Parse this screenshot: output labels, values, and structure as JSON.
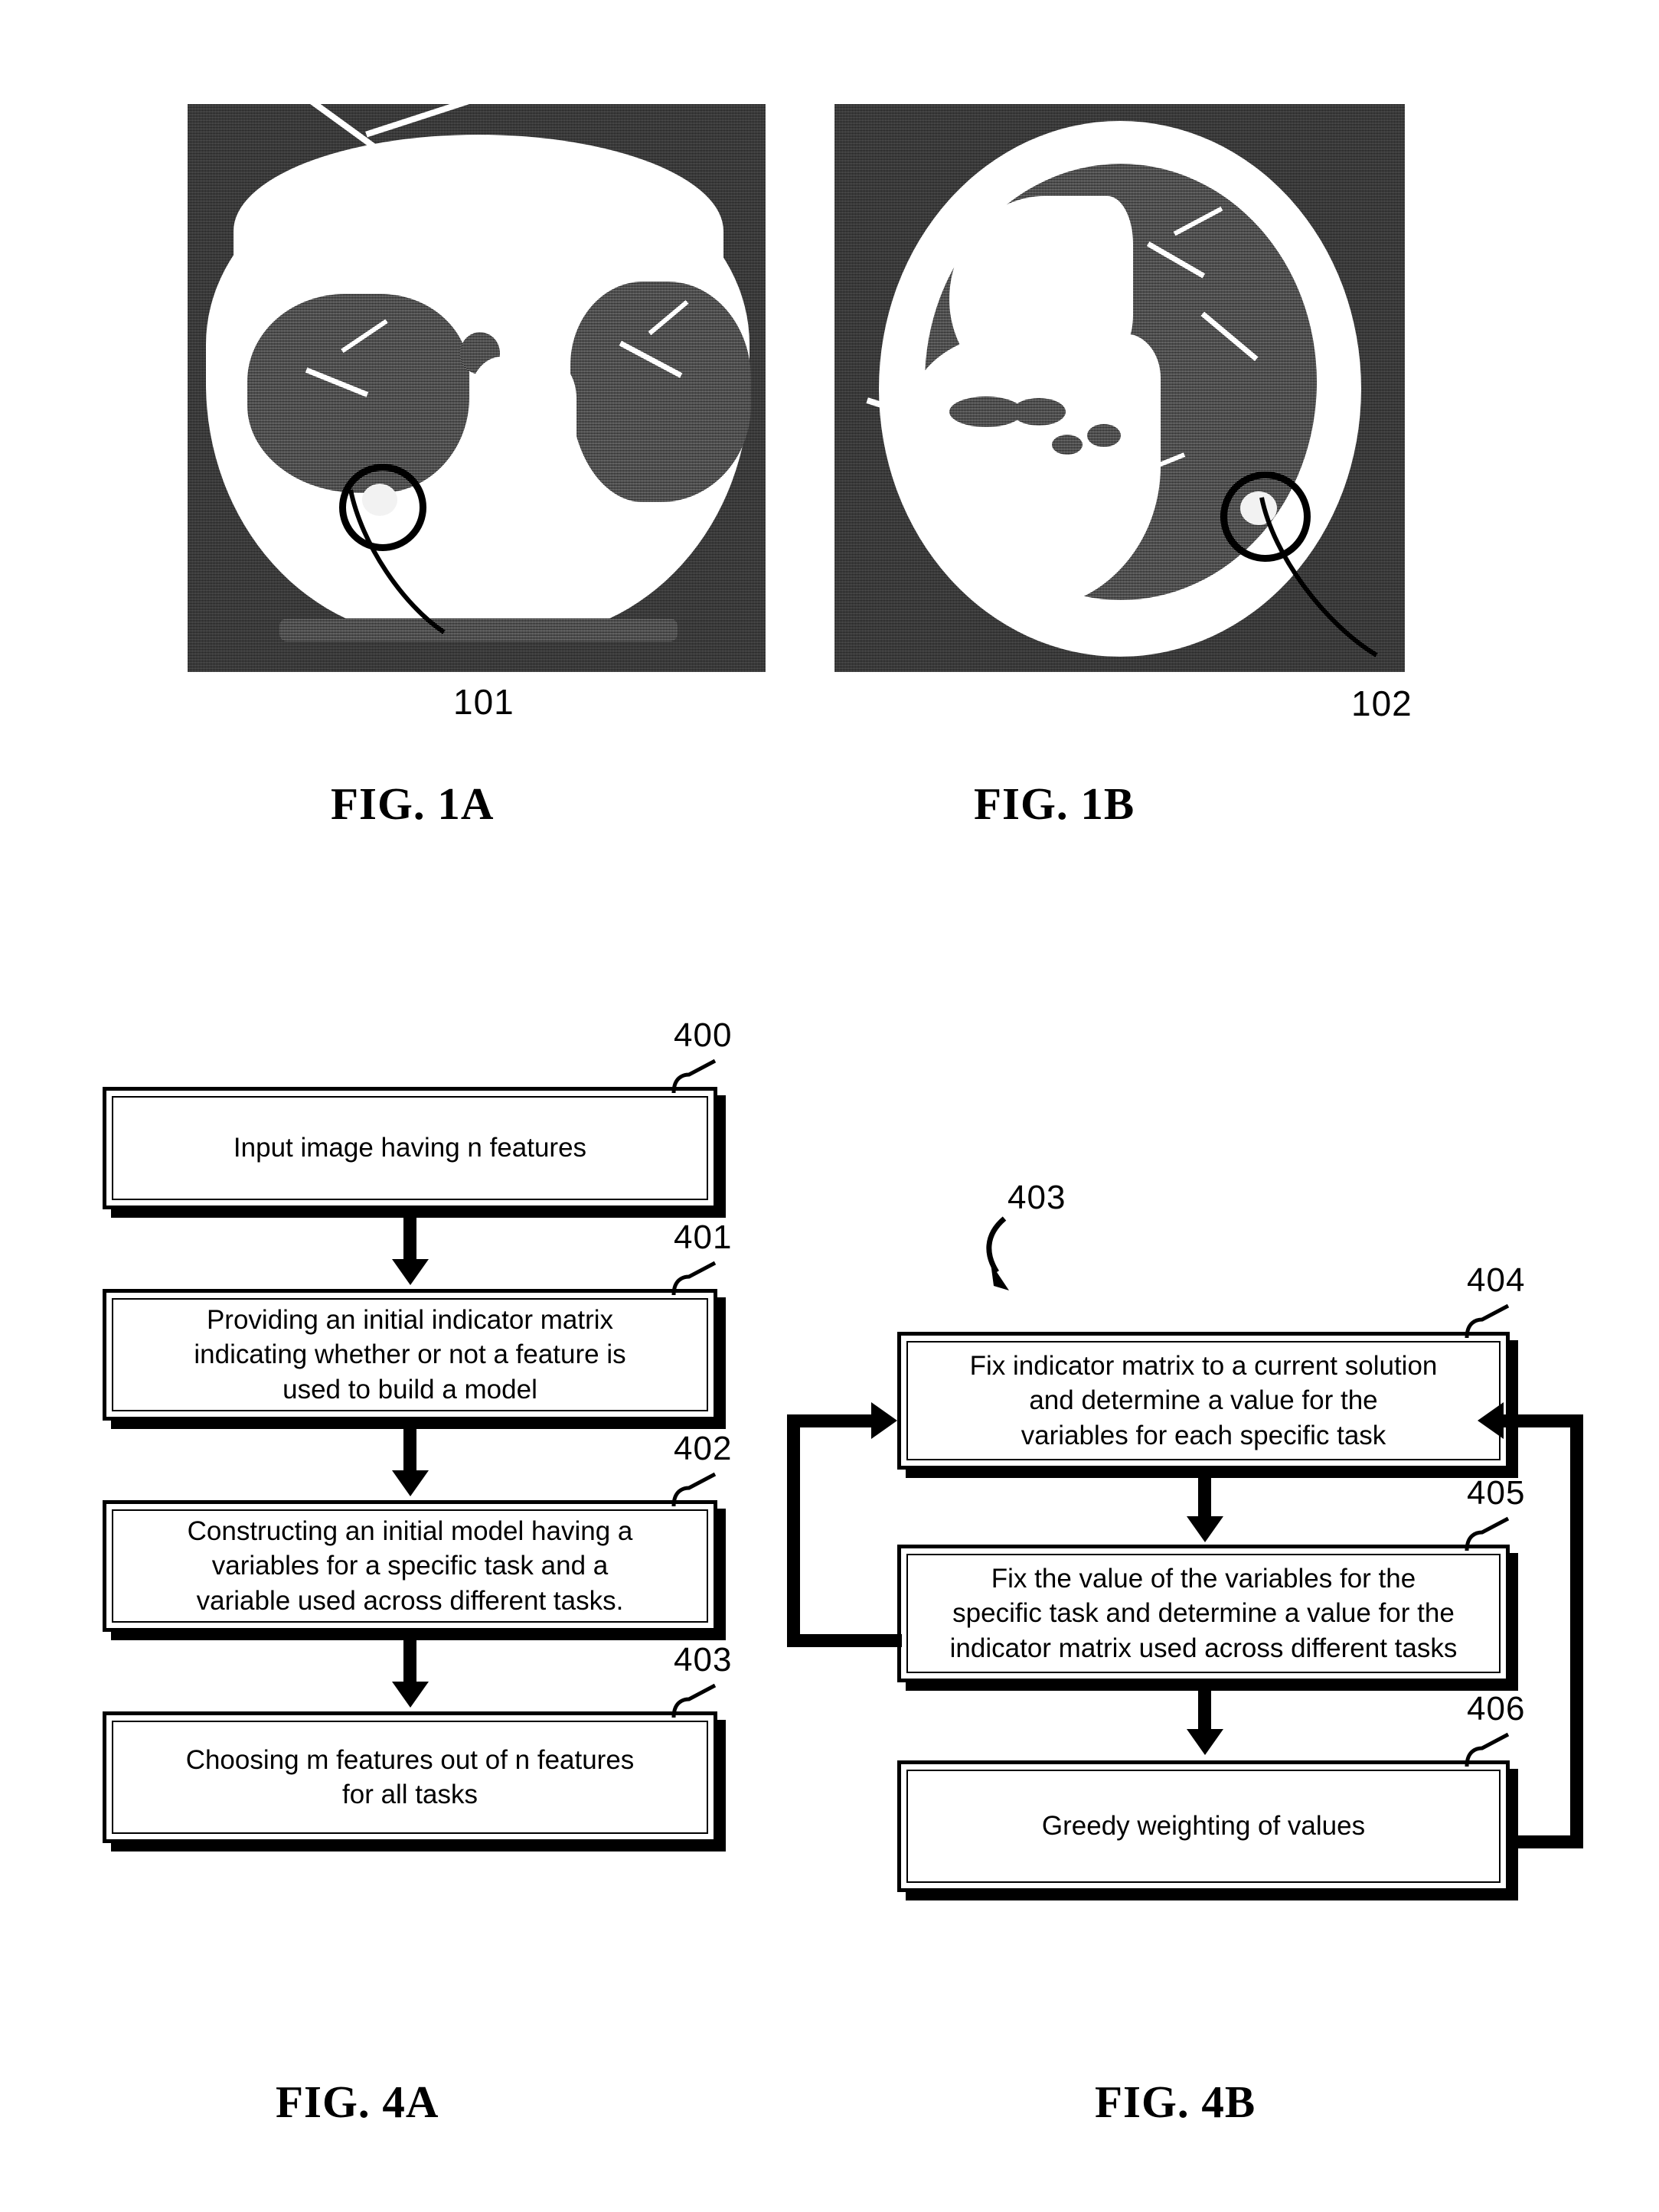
{
  "figures": {
    "fig1a": {
      "caption": "FIG. 1A",
      "ref_label": "101",
      "description": "axial CT slice of chest with circled lung nodule"
    },
    "fig1b": {
      "caption": "FIG. 1B",
      "ref_label": "102",
      "description": "axial CT slice of chest with circled lung nodule"
    },
    "fig4a": {
      "caption": "FIG. 4A",
      "steps": [
        {
          "ref": "400",
          "text": "Input image having n features"
        },
        {
          "ref": "401",
          "text": "Providing an initial indicator matrix\nindicating whether or not a feature is\nused to build a model"
        },
        {
          "ref": "402",
          "text": "Constructing an initial model having a\nvariables for a specific task and a\nvariable used across different tasks."
        },
        {
          "ref": "403",
          "text": "Choosing m features out of n features\nfor all tasks"
        }
      ]
    },
    "fig4b": {
      "caption": "FIG. 4B",
      "group_ref": "403",
      "steps": [
        {
          "ref": "404",
          "text": "Fix indicator matrix to a current solution\nand determine a value for the\nvariables for each specific task"
        },
        {
          "ref": "405",
          "text": "Fix the value of the variables for the\nspecific task and determine a value for the\nindicator matrix used across different tasks"
        },
        {
          "ref": "406",
          "text": "Greedy weighting of values"
        }
      ]
    }
  },
  "colors": {
    "ink": "#000000",
    "paper": "#ffffff"
  }
}
